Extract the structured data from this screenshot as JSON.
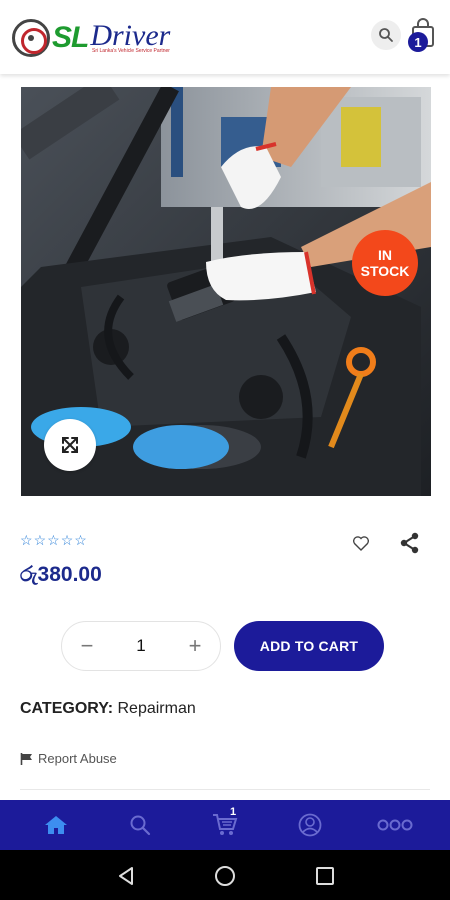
{
  "header": {
    "logo_sl": "SL",
    "logo_driver": "Driver",
    "logo_tagline": "Sri Lanka's Vehicle Service Partner",
    "search_icon": "search-icon",
    "cart_icon": "shopping-bag-icon",
    "cart_count": "1"
  },
  "product": {
    "image": "car-engine-repair-photo",
    "stock_badge": {
      "line1": "IN",
      "line2": "STOCK"
    },
    "zoom_icon": "expand-icon",
    "rating_stars": 5,
    "rating_value": 0,
    "price": "රු380.00",
    "wishlist_icon": "heart-icon",
    "share_icon": "share-icon"
  },
  "purchase": {
    "quantity": "1",
    "minus": "−",
    "plus": "+",
    "add_to_cart_label": "ADD TO CART"
  },
  "meta": {
    "category_label": "CATEGORY:",
    "category_value": "Repairman",
    "report_label": "Report Abuse",
    "report_icon": "flag-icon"
  },
  "bottom_nav": {
    "items": [
      {
        "icon": "home-icon",
        "active": true
      },
      {
        "icon": "search-icon",
        "active": false
      },
      {
        "icon": "cart-icon",
        "active": false,
        "badge": "1"
      },
      {
        "icon": "account-icon",
        "active": false
      },
      {
        "icon": "more-icon",
        "active": false
      }
    ]
  },
  "colors": {
    "brand": "#1c1b9a",
    "price": "#1c2a8c",
    "stock_badge": "#f3481b",
    "stars": "#2a7fd8",
    "nav_active": "#3d8ef0",
    "nav_inactive": "#6a6bd0"
  }
}
